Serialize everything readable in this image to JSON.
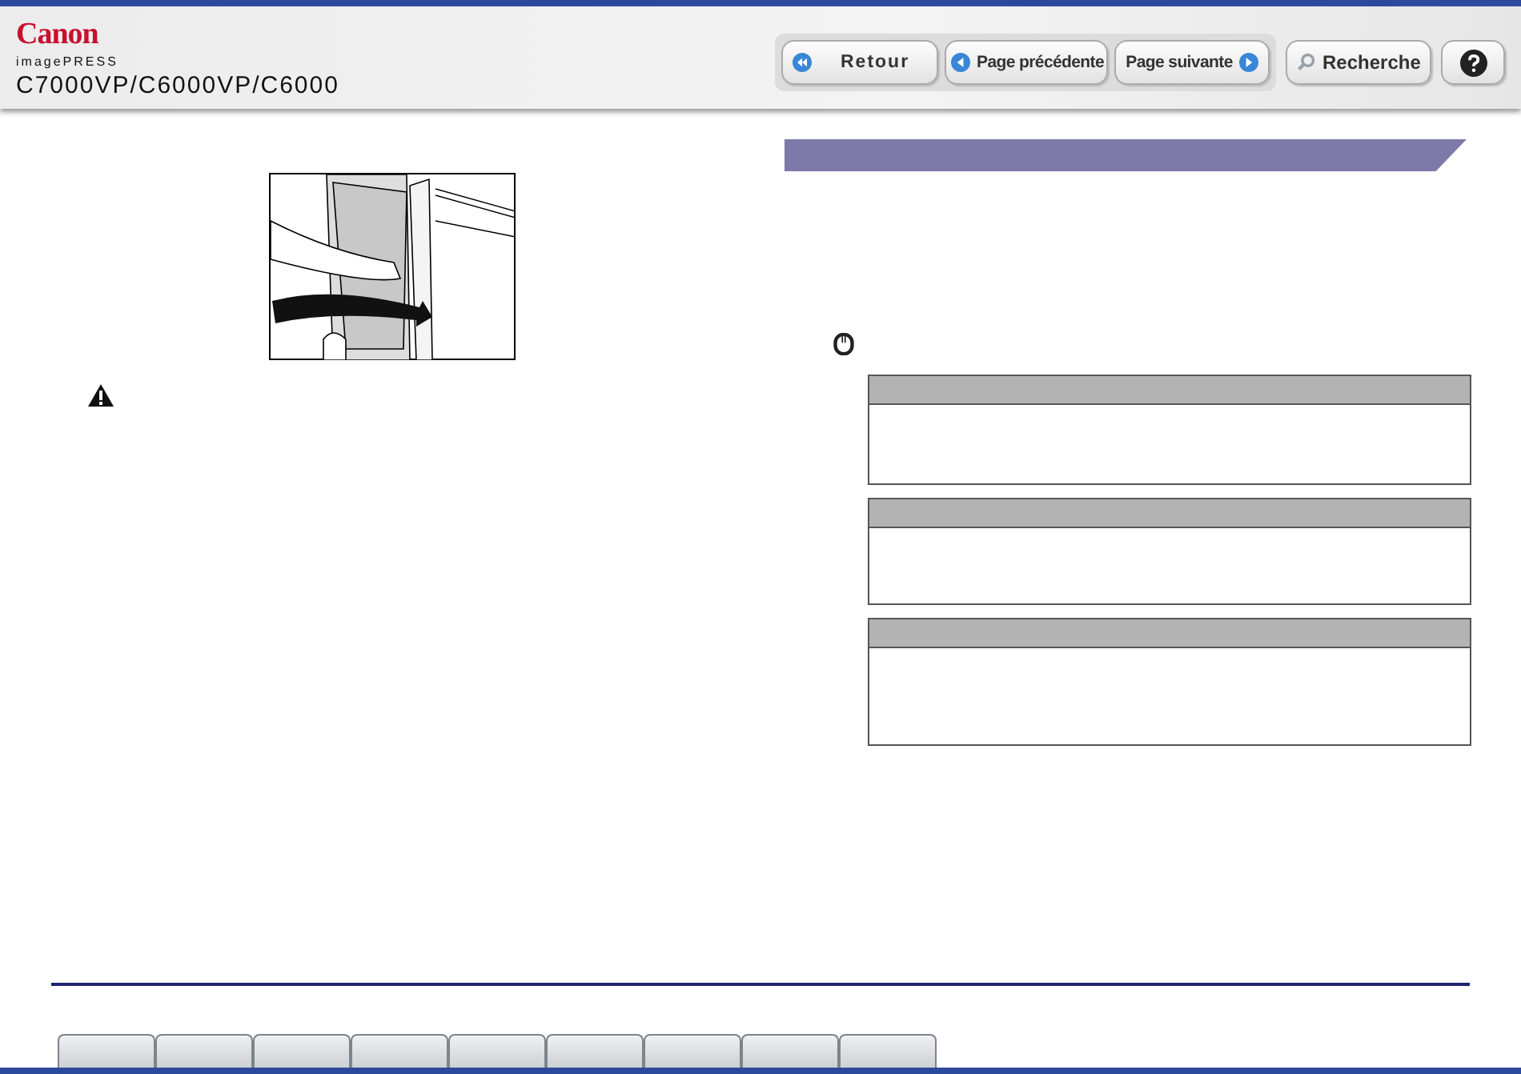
{
  "header": {
    "brand": "Canon",
    "product_line": "imagePRESS",
    "model": "C7000VP/C6000VP/C6000"
  },
  "nav_buttons": [
    {
      "kind": "back",
      "label": "Retour"
    },
    {
      "kind": "prev",
      "label": "Page précédente"
    },
    {
      "kind": "next",
      "label": "Page suivante"
    }
  ],
  "tool_buttons": [
    {
      "kind": "search",
      "label": "Recherche"
    },
    {
      "kind": "help"
    }
  ]
}
